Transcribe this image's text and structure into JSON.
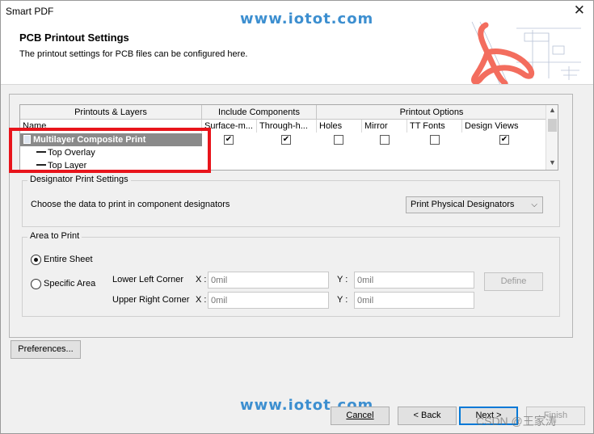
{
  "window": {
    "title": "Smart PDF",
    "close_glyph": "✕"
  },
  "watermark": {
    "text": "www.iotot.com"
  },
  "header": {
    "title": "PCB Printout Settings",
    "subtitle": "The printout settings for PCB files can be configured here."
  },
  "grid": {
    "group_headers": [
      "Printouts & Layers",
      "Include Components",
      "Printout Options"
    ],
    "columns": [
      "Name",
      "Surface-m...",
      "Through-h...",
      "Holes",
      "Mirror",
      "TT Fonts",
      "Design Views"
    ],
    "rows": [
      {
        "name": "Multilayer Composite Print",
        "selected": true,
        "checks": [
          true,
          true,
          false,
          false,
          false,
          true
        ]
      },
      {
        "name": "Top Overlay",
        "selected": false,
        "checks": []
      },
      {
        "name": "Top Layer",
        "selected": false,
        "checks": []
      }
    ]
  },
  "designator": {
    "group_title": "Designator Print Settings",
    "label": "Choose the data to print in component designators",
    "selected_option": "Print Physical Designators"
  },
  "area": {
    "group_title": "Area to Print",
    "option_entire": "Entire Sheet",
    "option_specific": "Specific Area",
    "selected": "Entire Sheet",
    "lower_left_label": "Lower Left Corner",
    "upper_right_label": "Upper Right Corner",
    "x_label": "X :",
    "y_label": "Y :",
    "ll_x_placeholder": "0mil",
    "ll_y_placeholder": "0mil",
    "ur_x_placeholder": "0mil",
    "ur_y_placeholder": "0mil",
    "define_label": "Define"
  },
  "buttons": {
    "preferences": "Preferences...",
    "cancel": "Cancel",
    "back": "< Back",
    "next": "Next >",
    "finish": "Finish"
  },
  "overlay": {
    "csdn": "CSDN @王家涛"
  },
  "colors": {
    "accent": "#0078d7",
    "highlight": "#e8141b",
    "watermark": "#3d8fd0",
    "selected_row": "#8a8a8a"
  }
}
